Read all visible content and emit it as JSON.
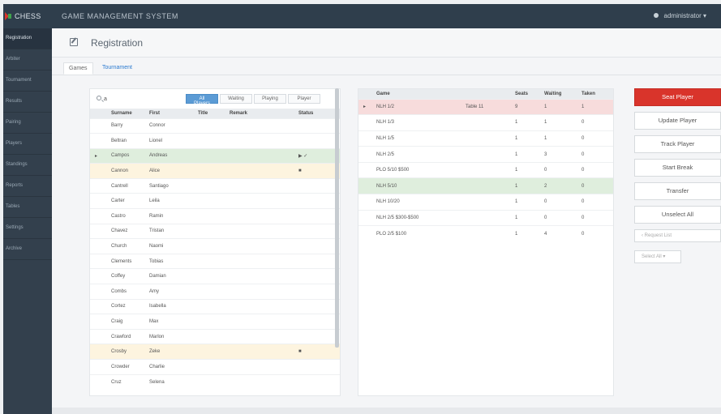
{
  "app": {
    "logo_text": "CHESS",
    "title": "GAME MANAGEMENT SYSTEM",
    "user": "administrator"
  },
  "sidebar": {
    "items": [
      {
        "label": "Registration"
      },
      {
        "label": "Arbiter"
      },
      {
        "label": "Tournament"
      },
      {
        "label": "Results"
      },
      {
        "label": "Pairing"
      },
      {
        "label": "Players"
      },
      {
        "label": "Standings"
      },
      {
        "label": "Reports"
      },
      {
        "label": "Tables"
      },
      {
        "label": "Settings"
      },
      {
        "label": "Archive"
      }
    ]
  },
  "header": {
    "title": "Registration",
    "tabs": [
      {
        "label": "Games"
      },
      {
        "label": "Tournament"
      }
    ]
  },
  "players_panel": {
    "search_value": "a",
    "filters": [
      {
        "label": "All Players"
      },
      {
        "label": "Waiting"
      },
      {
        "label": "Playing"
      },
      {
        "label": "Player"
      }
    ],
    "columns": [
      "Surname",
      "First",
      "Title",
      "Remark",
      "Status"
    ],
    "rows": [
      {
        "surname": "Barry",
        "first": "Connor",
        "status": ""
      },
      {
        "surname": "Beltran",
        "first": "Lionel",
        "status": ""
      },
      {
        "surname": "Campos",
        "first": "Andreas",
        "status": "▶ ✓",
        "style": "green",
        "marker": "▸"
      },
      {
        "surname": "Cannon",
        "first": "Alice",
        "status": "■",
        "style": "yellow"
      },
      {
        "surname": "Cantrell",
        "first": "Santiago",
        "status": ""
      },
      {
        "surname": "Carter",
        "first": "Leila",
        "status": ""
      },
      {
        "surname": "Castro",
        "first": "Ramin",
        "status": ""
      },
      {
        "surname": "Chavez",
        "first": "Tristan",
        "status": ""
      },
      {
        "surname": "Church",
        "first": "Naomi",
        "status": ""
      },
      {
        "surname": "Clements",
        "first": "Tobias",
        "status": ""
      },
      {
        "surname": "Coffey",
        "first": "Damian",
        "status": ""
      },
      {
        "surname": "Combs",
        "first": "Amy",
        "status": ""
      },
      {
        "surname": "Cortez",
        "first": "Isabella",
        "status": ""
      },
      {
        "surname": "Craig",
        "first": "Max",
        "status": ""
      },
      {
        "surname": "Crawford",
        "first": "Marlon",
        "status": ""
      },
      {
        "surname": "Crosby",
        "first": "Zeke",
        "status": "■",
        "style": "yellow"
      },
      {
        "surname": "Crowder",
        "first": "Charlie",
        "status": ""
      },
      {
        "surname": "Cruz",
        "first": "Selena",
        "status": ""
      }
    ]
  },
  "tables_panel": {
    "columns": [
      "Game",
      "",
      "Seats",
      "Waiting",
      "Taken"
    ],
    "rows": [
      {
        "game": "NLH 1/2",
        "note": "Table 11",
        "seats": "9",
        "waiting": "1",
        "taken": "1",
        "style": "red",
        "marker": "▸"
      },
      {
        "game": "NLH 1/3",
        "note": "",
        "seats": "1",
        "waiting": "1",
        "taken": "0"
      },
      {
        "game": "NLH 1/5",
        "note": "",
        "seats": "1",
        "waiting": "1",
        "taken": "0"
      },
      {
        "game": "NLH 2/5",
        "note": "",
        "seats": "1",
        "waiting": "3",
        "taken": "0"
      },
      {
        "game": "PLO 5/10 $500",
        "note": "",
        "seats": "1",
        "waiting": "0",
        "taken": "0"
      },
      {
        "game": "NLH 5/10",
        "note": "",
        "seats": "1",
        "waiting": "2",
        "taken": "0",
        "style": "green"
      },
      {
        "game": "NLH 10/20",
        "note": "",
        "seats": "1",
        "waiting": "0",
        "taken": "0"
      },
      {
        "game": "NLH 2/5 $300-$500",
        "note": "",
        "seats": "1",
        "waiting": "0",
        "taken": "0"
      },
      {
        "game": "PLO 2/5 $100",
        "note": "",
        "seats": "1",
        "waiting": "4",
        "taken": "0"
      }
    ]
  },
  "actions": {
    "buttons": [
      {
        "label": "Seat Player"
      },
      {
        "label": "Update Player"
      },
      {
        "label": "Track Player"
      },
      {
        "label": "Start Break"
      },
      {
        "label": "Transfer"
      },
      {
        "label": "Unselect All"
      }
    ],
    "request_list": "Request List",
    "select_placeholder": "Select All"
  },
  "colors": {
    "topbar": "#2f3e4c",
    "sidebar": "#33404d",
    "primary": "#d9342b",
    "filter_active": "#5b9bd5",
    "row_green": "#dfeedd",
    "row_yellow": "#fdf4df",
    "row_red": "#f7dcdc"
  }
}
